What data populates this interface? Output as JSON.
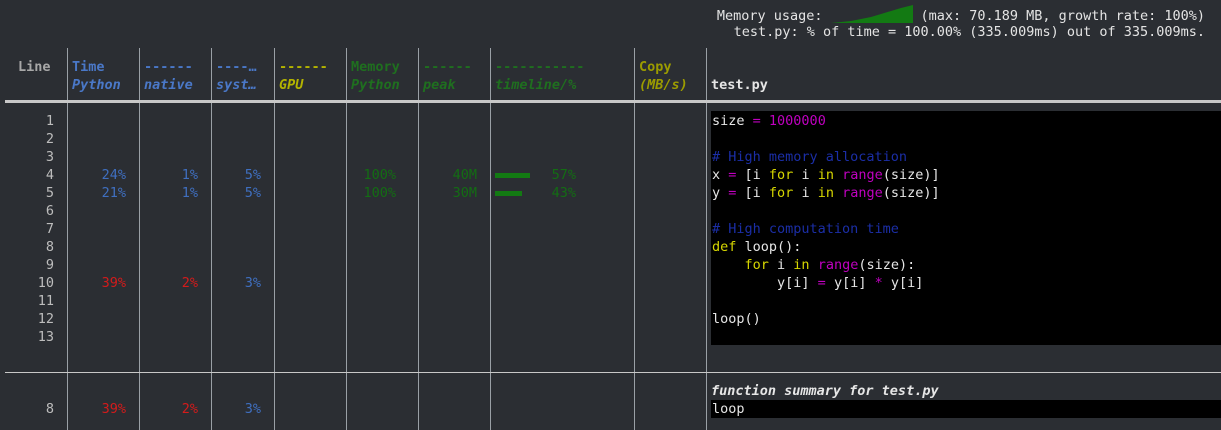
{
  "header": {
    "memory_label": "Memory usage:",
    "memory_stats": "(max: 70.189 MB, growth rate: 100%)",
    "time_summary": "test.py: % of time = 100.00% (335.009ms) out of 335.009ms."
  },
  "columns": {
    "line": "Line",
    "time": "Time",
    "time_python": "Python",
    "native_dash": "------",
    "native": "native",
    "system_dash": "----…",
    "system": "syst…",
    "gpu_dash": "------",
    "gpu": "GPU",
    "memory": "Memory",
    "memory_python": "Python",
    "peak_dash": "------",
    "peak": "peak",
    "timeline_dash": "-----------",
    "timeline": "timeline/%",
    "copy": "Copy",
    "copy_unit": "(MB/s)",
    "file": "test.py"
  },
  "rows": [
    {
      "line": "1",
      "code": "size = 1000000"
    },
    {
      "line": "2",
      "code": ""
    },
    {
      "line": "3",
      "code": "# High memory allocation"
    },
    {
      "line": "4",
      "time_python": "24%",
      "time_native": "1%",
      "time_system": "5%",
      "mem_python": "100%",
      "mem_peak": "40M",
      "timeline_pct": "57%",
      "timeline_frac": 0.57,
      "code": "x = [i for i in range(size)]"
    },
    {
      "line": "5",
      "time_python": "21%",
      "time_native": "1%",
      "time_system": "5%",
      "mem_python": "100%",
      "mem_peak": "30M",
      "timeline_pct": "43%",
      "timeline_frac": 0.43,
      "code": "y = [i for i in range(size)]"
    },
    {
      "line": "6",
      "code": ""
    },
    {
      "line": "7",
      "code": "# High computation time"
    },
    {
      "line": "8",
      "code": "def loop():"
    },
    {
      "line": "9",
      "code": "    for i in range(size):"
    },
    {
      "line": "10",
      "time_python": "39%",
      "time_native": "2%",
      "time_system": "3%",
      "code": "        y[i] = y[i] * y[i]"
    },
    {
      "line": "11",
      "code": ""
    },
    {
      "line": "12",
      "code": "loop()"
    },
    {
      "line": "13",
      "code": ""
    }
  ],
  "summary": {
    "title": "function summary for test.py",
    "line": "8",
    "time_python": "39%",
    "time_native": "2%",
    "time_system": "3%",
    "function": "loop"
  },
  "colors": {
    "background": "#2b2e33",
    "time_blue": "#3f6fc0",
    "hot_red": "#d41b1b",
    "memory_green": "#136d13",
    "keyword_yellow": "#d7d700",
    "magenta": "#c000c0",
    "comment_blue": "#1b2ea6"
  }
}
